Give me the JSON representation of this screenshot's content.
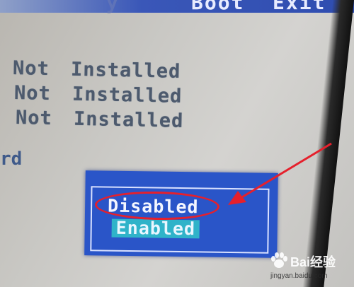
{
  "menu": {
    "partial_item": "y",
    "boot_label": "Boot",
    "exit_label": "Exit"
  },
  "settings": [
    {
      "label": "Not",
      "value": "Installed"
    },
    {
      "label": "Not",
      "value": "Installed"
    },
    {
      "label": "Not",
      "value": "Installed"
    }
  ],
  "side_label": "rd",
  "popup": {
    "options": [
      {
        "label": "Disabled",
        "selected": false
      },
      {
        "label": "Enabled",
        "selected": true
      }
    ],
    "highlighted_option": "Disabled"
  },
  "watermark": {
    "brand": "Bai经验",
    "url": "jingyan.baidu.com"
  },
  "colors": {
    "menu_bar": "#2f4db0",
    "popup_bg": "#2a55c8",
    "selection_bg": "#2fb3c9",
    "annotation_red": "#e5202c"
  }
}
